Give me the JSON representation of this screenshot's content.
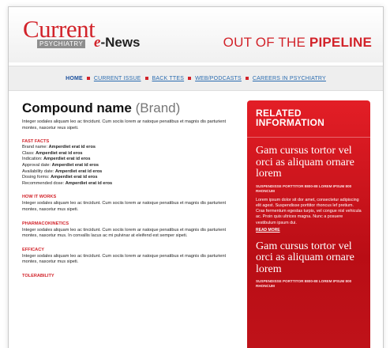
{
  "header": {
    "logo_main": "Current",
    "logo_sub": "PSYCHIATRY",
    "logo_e": "e",
    "logo_news": "-News",
    "tagline_prefix": "OUT OF THE ",
    "tagline_bold": "PIPELINE"
  },
  "nav": {
    "items": [
      "HOME",
      "CURRENT ISSUE",
      "BACK TTES",
      "WEB/PODCASTS",
      "CAREERS IN PSYCHIATRY"
    ]
  },
  "main": {
    "title": "Compound name",
    "brand": "(Brand)",
    "intro": "Integer sodales aliquam leo ac tincidunt. Cum sociis lorem ar natoque penatibus et magnis dis parturient montes, nascetur reus sipeti.",
    "fast_facts": {
      "heading": "FAST FACTS",
      "rows": [
        {
          "label": "Brand name: ",
          "value": "Amperdiet erat id eros"
        },
        {
          "label": "Class: ",
          "value": "Amperdiet erat id eros"
        },
        {
          "label": "Indication: ",
          "value": "Amperdiet erat id eros"
        },
        {
          "label": "Approval date: ",
          "value": "Amperdiet erat id eros"
        },
        {
          "label": "Availability date: ",
          "value": "Amperdiet erat id eros"
        },
        {
          "label": "Dosing forms: ",
          "value": "Amperdiet erat id eros"
        },
        {
          "label": "Recommended dose: ",
          "value": "Amperdiet erat id eros"
        }
      ]
    },
    "how_it_works": {
      "heading": "HOW IT WORKS",
      "text": "Integer sodales aliquam leo ac tincidunt. Cum sociis lorem ar natoque penatibus et magnis dis parturient montes, nascetur mus sipeti."
    },
    "pharmacokinetics": {
      "heading": "PHARMACOKINETICS",
      "text": "Integer sodales aliquam leo ac tincidunt. Cum sociis lorem ar natoque penatibus et magnis dis parturient montes, nascetur mus. In convallis lacus ac mi pulvinar at eleifend est semper sipeti."
    },
    "efficacy": {
      "heading": "EFFICACY",
      "text": "Integer sodales aliquam leo ac tincidunt. Cum sociis lorem ar natoque penatibus et magnis dis parturient montes, nascetur mus sipeti."
    },
    "tolerability": {
      "heading": "TOLERABILITY"
    }
  },
  "sidebar": {
    "title_line1": "RELATED",
    "title_line2": "INFORMATION",
    "item1": {
      "headline": "Gam cursus tortor vel orci as aliquam ornare lorem",
      "sub": "SUSPENDISSE PORTTITOR 8800-88 LOREM IPSUM 800 RHONCUM",
      "body": "Lorem ipsum dolor sit dor amet, consectetur adipiscing elit agest. Suspendisse porttitor rhoncus lef pretium. Cras fermentum egestas turpis, vel congue nisl vehicula ac. Proin quis ultrices magna. Nunc a posuere vestibulum ipsum dui.",
      "more": "READ MORE"
    },
    "item2": {
      "headline": "Gam cursus tortor vel orci as aliquam ornare lorem",
      "sub": "SUSPENDISSE PORTTITOR 8800-88 LOREM IPSUM 800 RHONCUM"
    }
  },
  "colors": {
    "accent": "#d2232a",
    "sidebar": "#c8141c",
    "link": "#2b6cb0"
  }
}
